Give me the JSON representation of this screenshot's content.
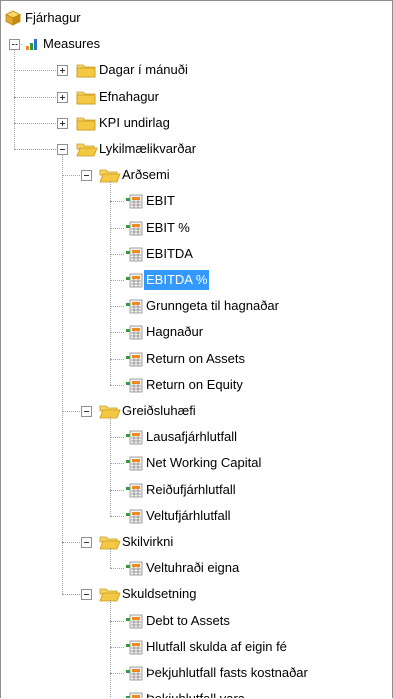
{
  "root": {
    "label": "Fjárhagur",
    "icon": "cube-icon"
  },
  "measures": {
    "label": "Measures",
    "icon": "bar-chart-icon",
    "expanded": true
  },
  "folders": [
    {
      "label": "Dagar í mánuði",
      "expanded": false
    },
    {
      "label": "Efnahagur",
      "expanded": false
    },
    {
      "label": "KPI undirlag",
      "expanded": false
    },
    {
      "label": "Lykilmælikvarðar",
      "expanded": true
    }
  ],
  "groups": [
    {
      "label": "Arðsemi",
      "items": [
        "EBIT",
        "EBIT %",
        "EBITDA",
        "EBITDA %",
        "Grunngeta til hagnaðar",
        "Hagnaður",
        "Return on Assets",
        "Return on Equity"
      ]
    },
    {
      "label": "Greiðsluhæfi",
      "items": [
        "Lausafjárhlutfall",
        "Net Working Capital",
        "Reiðufjárhlutfall",
        "Veltufjárhlutfall"
      ]
    },
    {
      "label": "Skilvirkni",
      "items": [
        "Veltuhraði eigna"
      ]
    },
    {
      "label": "Skuldsetning",
      "items": [
        "Debt to Assets",
        "Hlutfall skulda af eigin fé",
        "Þekjuhlutfall fasts kostnaðar",
        "Þekjuhlutfall vara"
      ]
    }
  ],
  "selected_item": "EBITDA %",
  "colors": {
    "selection": "#3399ff",
    "folder": "#f4c842",
    "measure_green": "#2e9a3a",
    "measure_orange": "#f08a1c"
  }
}
